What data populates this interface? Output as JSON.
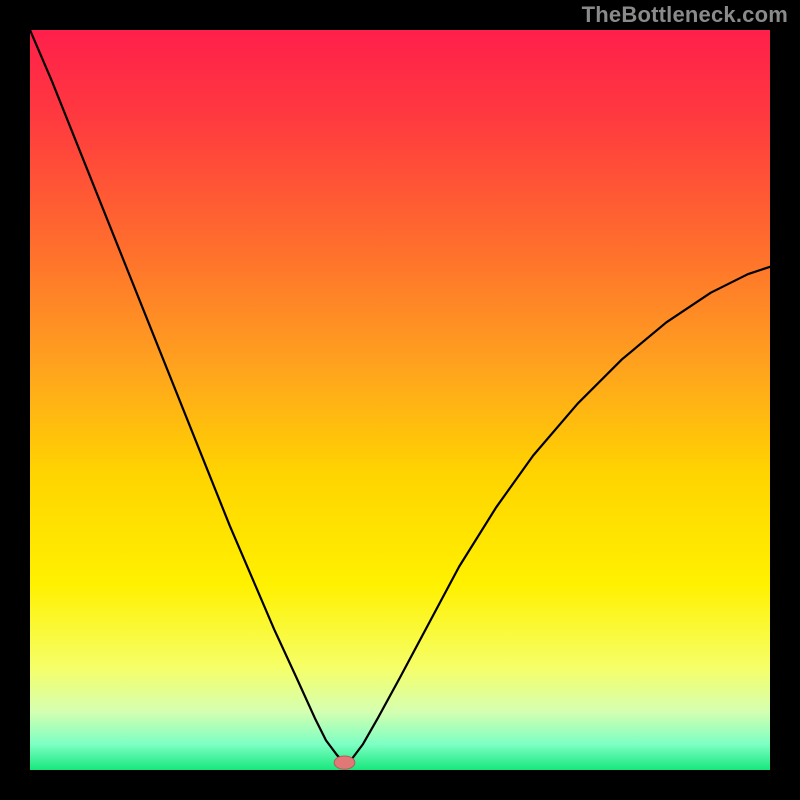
{
  "watermark": "TheBottleneck.com",
  "chart_data": {
    "type": "line",
    "title": "",
    "xlabel": "",
    "ylabel": "",
    "xlim": [
      0,
      100
    ],
    "ylim": [
      0,
      100
    ],
    "grid": false,
    "legend": false,
    "annotations": [],
    "background": {
      "gradient_stops": [
        {
          "offset": 0.0,
          "color": "#ff1f4b"
        },
        {
          "offset": 0.12,
          "color": "#ff3a3f"
        },
        {
          "offset": 0.28,
          "color": "#ff6a2e"
        },
        {
          "offset": 0.45,
          "color": "#ffa11f"
        },
        {
          "offset": 0.6,
          "color": "#ffd400"
        },
        {
          "offset": 0.75,
          "color": "#fff100"
        },
        {
          "offset": 0.86,
          "color": "#f6ff66"
        },
        {
          "offset": 0.92,
          "color": "#d6ffb0"
        },
        {
          "offset": 0.965,
          "color": "#7dffc3"
        },
        {
          "offset": 1.0,
          "color": "#17e77d"
        }
      ]
    },
    "series": [
      {
        "name": "bottleneck-curve",
        "stroke": "#000000",
        "stroke_width": 2.2,
        "x": [
          0,
          3,
          6,
          9,
          12,
          15,
          18,
          21,
          24,
          27,
          30,
          33,
          36,
          38.5,
          40,
          41.5,
          42.5,
          43.5,
          45,
          47,
          50,
          54,
          58,
          63,
          68,
          74,
          80,
          86,
          92,
          97,
          100
        ],
        "y": [
          100,
          93,
          85.5,
          78,
          70.5,
          63,
          55.5,
          48,
          40.5,
          33,
          26,
          19,
          12.5,
          7,
          4,
          2,
          1,
          1.5,
          3.5,
          7,
          12.5,
          20,
          27.5,
          35.5,
          42.5,
          49.5,
          55.5,
          60.5,
          64.5,
          67,
          68
        ]
      }
    ],
    "marker": {
      "name": "optimal-point",
      "x": 42.5,
      "y": 1,
      "rx": 1.4,
      "ry": 0.9,
      "fill": "#e07878",
      "stroke": "#b85a5a"
    }
  }
}
